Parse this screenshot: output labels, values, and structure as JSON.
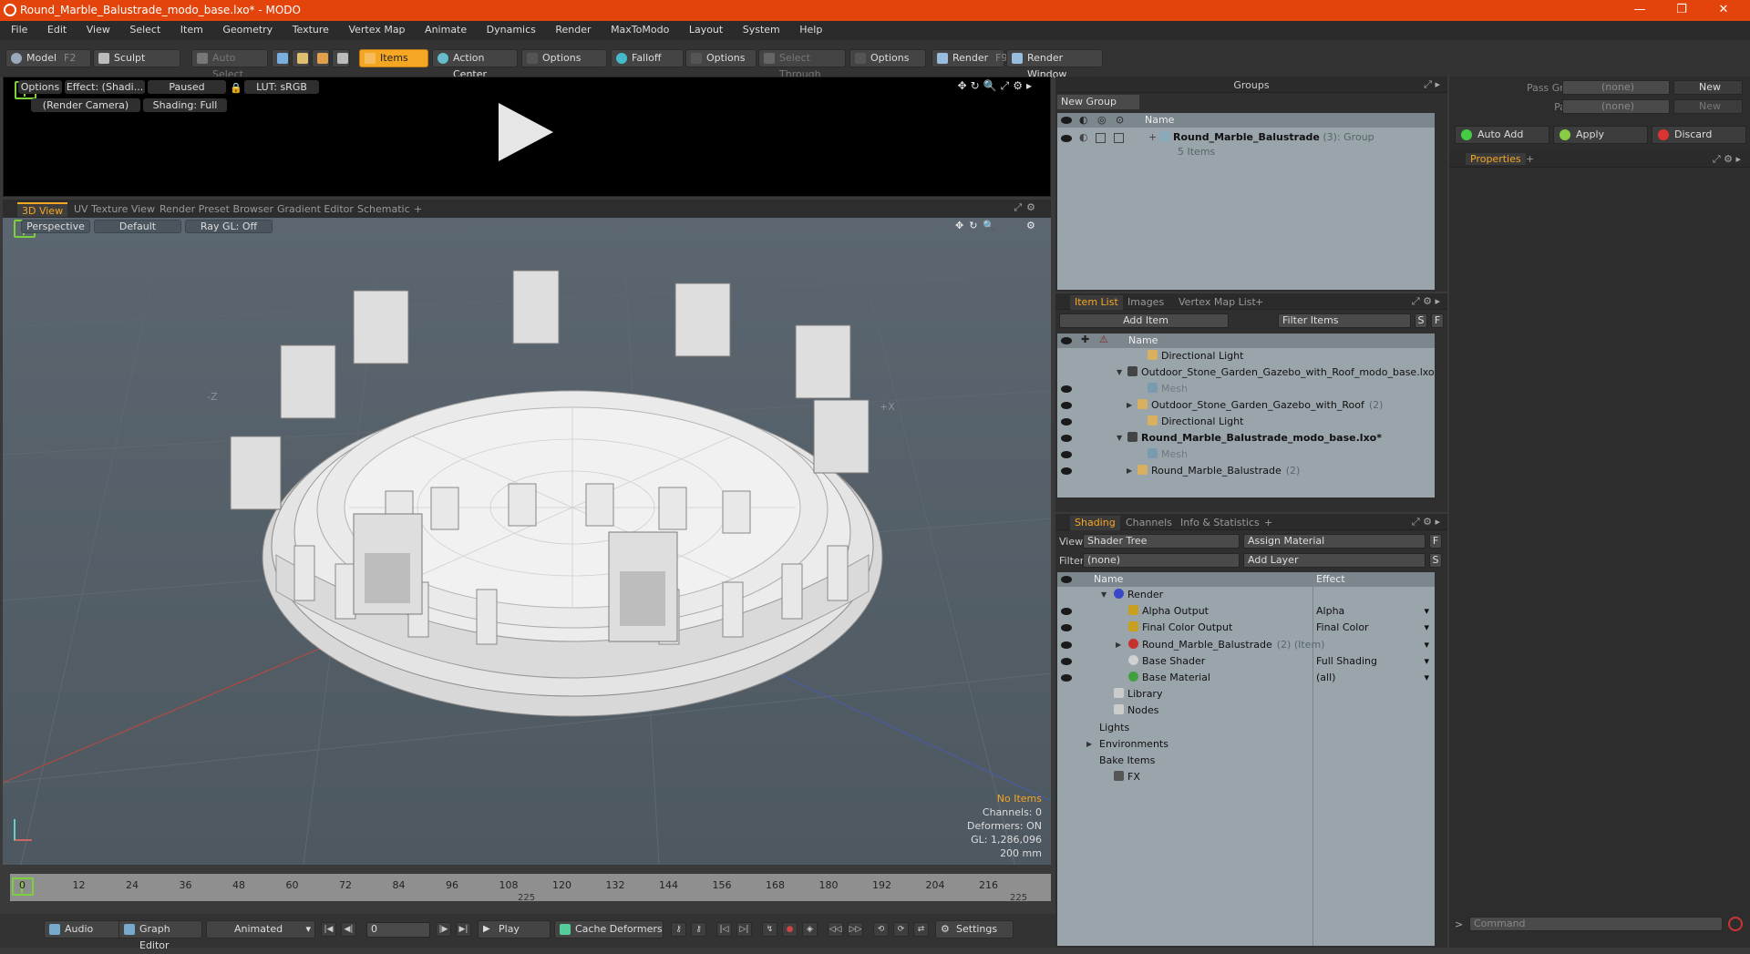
{
  "window": {
    "title": "Round_Marble_Balustrade_modo_base.lxo* - MODO",
    "controls": [
      "—",
      "❐",
      "✕"
    ]
  },
  "menu": [
    "File",
    "Edit",
    "View",
    "Select",
    "Item",
    "Geometry",
    "Texture",
    "Vertex Map",
    "Animate",
    "Dynamics",
    "Render",
    "MaxToModo",
    "Layout",
    "System",
    "Help"
  ],
  "toolbar": {
    "model": "Model",
    "model_key": "F2",
    "sculpt": "Sculpt",
    "auto_select": "Auto Select",
    "items": "Items",
    "action_center": "Action Center",
    "options1": "Options",
    "falloff": "Falloff",
    "options2": "Options",
    "select_through": "Select Through",
    "options3": "Options",
    "render": "Render",
    "render_key": "F9",
    "render_window": "Render Window"
  },
  "preview": {
    "options": "Options",
    "effect": "Effect: (Shadi...",
    "paused": "Paused",
    "lut": "LUT: sRGB",
    "camera": "(Render Camera)",
    "shading": "Shading: Full"
  },
  "view_tabs": [
    "3D View",
    "UV Texture View",
    "Render Preset Browser",
    "Gradient Editor",
    "Schematic",
    "+"
  ],
  "viewport": {
    "perspective": "Perspective",
    "default": "Default",
    "raygl": "Ray GL: Off",
    "axis_neg_z": "-Z",
    "axis_pos_x": "+X",
    "stats": {
      "no_items": "No Items",
      "channels": "Channels: 0",
      "deformers": "Deformers: ON",
      "gl": "GL: 1,286,096",
      "scale": "200 mm"
    }
  },
  "timeline": {
    "ticks": [
      "0",
      "12",
      "24",
      "36",
      "48",
      "60",
      "72",
      "84",
      "96",
      "108",
      "120",
      "132",
      "144",
      "156",
      "168",
      "180",
      "192",
      "204",
      "216"
    ],
    "end_a": "225",
    "end_b": "225"
  },
  "bottom": {
    "audio": "Audio",
    "graph_editor": "Graph Editor",
    "animated": "Animated",
    "frame": "0",
    "play": "Play",
    "cache_deformers": "Cache Deformers",
    "settings": "Settings"
  },
  "groups": {
    "title": "Groups",
    "new_group": "New Group",
    "col_name": "Name",
    "item_name": "Round_Marble_Balustrade",
    "item_count": "(3)",
    "item_type": ": Group",
    "item_sub": "5 Items"
  },
  "itemlist": {
    "tabs": [
      "Item List",
      "Images",
      "Vertex Map List",
      "+"
    ],
    "add_item": "Add Item",
    "filter": "Filter Items",
    "s": "S",
    "f": "F",
    "col_name": "Name",
    "rows": [
      {
        "label": "Directional Light",
        "indent": 3,
        "bold": false,
        "gray": false,
        "eye": false,
        "arrow": ""
      },
      {
        "label": "Outdoor_Stone_Garden_Gazebo_with_Roof_modo_base.lxo",
        "indent": 1,
        "bold": false,
        "gray": false,
        "eye": false,
        "arrow": "▼"
      },
      {
        "label": "Mesh",
        "indent": 3,
        "bold": false,
        "gray": true,
        "eye": true,
        "arrow": ""
      },
      {
        "label": "Outdoor_Stone_Garden_Gazebo_with_Roof",
        "count": "(2)",
        "indent": 2,
        "bold": false,
        "gray": false,
        "eye": true,
        "arrow": "▶"
      },
      {
        "label": "Directional Light",
        "indent": 3,
        "bold": false,
        "gray": false,
        "eye": true,
        "arrow": ""
      },
      {
        "label": "Round_Marble_Balustrade_modo_base.lxo*",
        "indent": 1,
        "bold": true,
        "gray": false,
        "eye": true,
        "arrow": "▼"
      },
      {
        "label": "Mesh",
        "indent": 3,
        "bold": false,
        "gray": true,
        "eye": true,
        "arrow": ""
      },
      {
        "label": "Round_Marble_Balustrade",
        "count": "(2)",
        "indent": 2,
        "bold": false,
        "gray": false,
        "eye": true,
        "arrow": "▶"
      }
    ]
  },
  "shading": {
    "tabs": [
      "Shading",
      "Channels",
      "Info & Statistics",
      "+"
    ],
    "view_label": "View",
    "view_value": "Shader Tree",
    "assign_material": "Assign Material",
    "f": "F",
    "filter_label": "Filter",
    "filter_value": "(none)",
    "add_layer": "Add Layer",
    "s": "S",
    "col_name": "Name",
    "col_effect": "Effect",
    "rows": [
      {
        "label": "Render",
        "effect": "",
        "indent": 1,
        "eye": false,
        "arrow": "▼",
        "icon": "#3848c8"
      },
      {
        "label": "Alpha Output",
        "effect": "Alpha",
        "indent": 2,
        "eye": true,
        "arrow": "",
        "icon": "#c8a020"
      },
      {
        "label": "Final Color Output",
        "effect": "Final Color",
        "indent": 2,
        "eye": true,
        "arrow": "",
        "icon": "#c8a020"
      },
      {
        "label": "Round_Marble_Balustrade",
        "suffix": "(2) (Item)",
        "effect": "",
        "indent": 2,
        "eye": true,
        "arrow": "▶",
        "icon": "#c83030"
      },
      {
        "label": "Base Shader",
        "effect": "Full Shading",
        "indent": 2,
        "eye": true,
        "arrow": "",
        "icon": "#d0d0d0"
      },
      {
        "label": "Base Material",
        "effect": "(all)",
        "indent": 2,
        "eye": true,
        "arrow": "",
        "icon": "#40a040"
      },
      {
        "label": "Library",
        "effect": "",
        "indent": 1,
        "eye": false,
        "arrow": "",
        "icon": "#cccccc"
      },
      {
        "label": "Nodes",
        "effect": "",
        "indent": 1,
        "eye": false,
        "arrow": "",
        "icon": "#cccccc"
      },
      {
        "label": "Lights",
        "effect": "",
        "indent": 0,
        "eye": false,
        "arrow": "",
        "icon": ""
      },
      {
        "label": "Environments",
        "effect": "",
        "indent": 0,
        "eye": false,
        "arrow": "▶",
        "icon": ""
      },
      {
        "label": "Bake Items",
        "effect": "",
        "indent": 0,
        "eye": false,
        "arrow": "",
        "icon": ""
      },
      {
        "label": "FX",
        "effect": "",
        "indent": 1,
        "eye": false,
        "arrow": "",
        "icon": "#555555"
      }
    ]
  },
  "right": {
    "pass_groups": "Pass Groups",
    "pass_groups_value": "(none)",
    "passes": "Passes",
    "passes_value": "(none)",
    "new1": "New",
    "new2": "New",
    "auto_add": "Auto Add",
    "apply": "Apply",
    "discard": "Discard",
    "properties": "Properties",
    "plus": "+",
    "command": "Command"
  },
  "colors": {
    "accent": "#f5a623",
    "titlebar": "#e2440c",
    "viewport": "#55606a"
  }
}
